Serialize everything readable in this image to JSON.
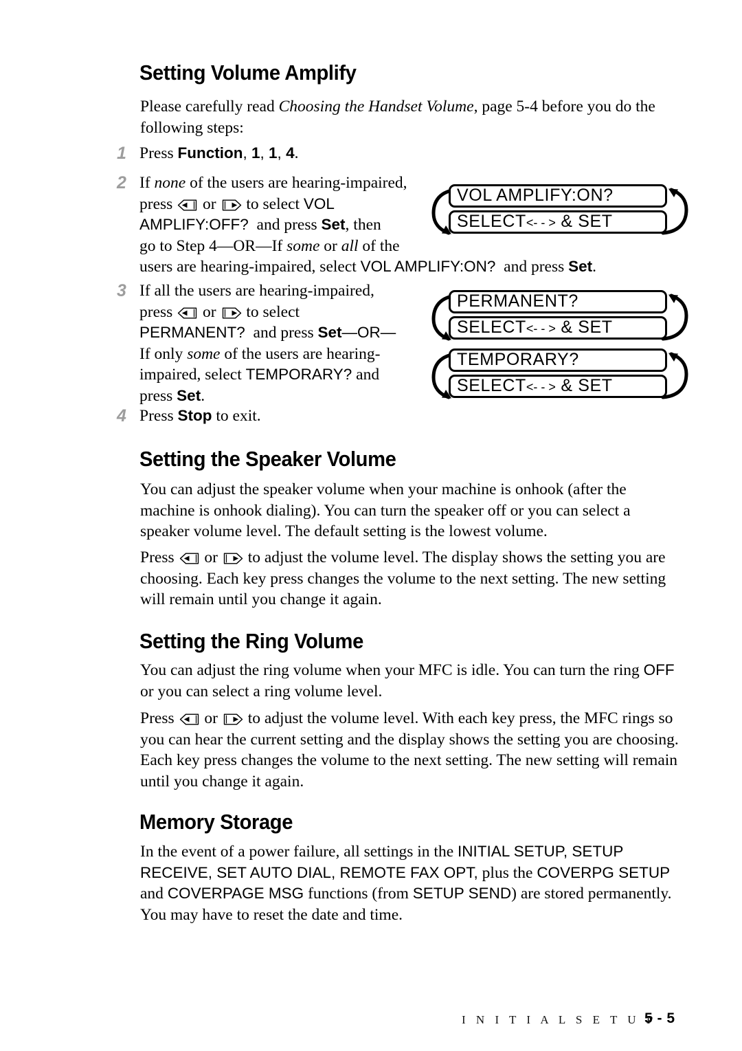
{
  "document": {
    "page_label": "5 - 5",
    "chapter_footer": "I N I T I A L   S E T U P"
  },
  "sections": [
    {
      "id": "volume-amplify",
      "heading": "Setting Volume Amplify",
      "intro_html": "Please carefully read <i>Choosing the Handset Volume</i>, page 5-4 before you do the following steps:",
      "steps": [
        {
          "number": "1",
          "html": "Press <b class=\"sansb\">Function</b><span class=\"sans\">, </span><b class=\"sansb\">1</b><span class=\"sans\">, </span><b class=\"sansb\">1</b><span class=\"sans\">, </span><b class=\"sansb\">4</b>."
        },
        {
          "number": "2",
          "html": "If <i>none</i> of the users are hearing-impaired,<br>press KEYLEFT or KEYRIGHT to select <span class=\"sans\">VOL</span><br><span class=\"sans\">AMPLIFY:OFF?</span>&nbsp; and press <b class=\"sansb\">Set</b>, then<br>go to Step 4—OR—If <i>some</i> or <i>all</i> of the<br>users are hearing-impaired, select <span class=\"sans\">VOL AMPLIFY:ON?</span>&nbsp; and press <b class=\"sansb\">Set</b>."
        },
        {
          "number": "3",
          "html": "If all the users are hearing-impaired,<br>press KEYLEFT or KEYRIGHT to select<br><span class=\"sans\">PERMANENT?</span>&nbsp; and press <b class=\"sansb\">Set</b><span class=\"sans\">—OR—</span><br>If only <i>some</i> of the users are hearing-<br>impaired, select <span class=\"sans\">TEMPORARY?</span> and<br>press <b class=\"sansb\">Set</b>."
        },
        {
          "number": "4",
          "html": "Press <b class=\"sansb\">Stop</b> to exit."
        }
      ],
      "displays": [
        {
          "id": "vol-amplify-on",
          "line1": "VOL AMPLIFY:ON?",
          "line2_pre": "SELECT",
          "line2_arrows": "<- - >",
          "line2_post": " & SET"
        },
        {
          "id": "permanent",
          "line1": "PERMANENT?",
          "line2_pre": "SELECT",
          "line2_arrows": "<- - >",
          "line2_post": " & SET"
        },
        {
          "id": "temporary",
          "line1": "TEMPORARY?",
          "line2_pre": "SELECT",
          "line2_arrows": "<- - >",
          "line2_post": " & SET"
        }
      ]
    },
    {
      "id": "speaker-volume",
      "heading": "Setting the Speaker Volume",
      "paragraphs": [
        "You can adjust the speaker volume when your machine is onhook (after the machine is onhook dialing). You can turn the speaker off or you can select a speaker volume level. The default setting is the lowest volume.",
        "Press KEYLEFT or KEYRIGHT to adjust the volume level. The display shows the setting you are choosing. Each key press changes the volume to the next setting. The new setting will remain until you change it again."
      ]
    },
    {
      "id": "ring-volume",
      "heading": "Setting the Ring Volume",
      "paragraphs": [
        "You can adjust the ring volume when your MFC is idle. You can turn the ring <span class=\"sans\">OFF</span> or you can select a ring volume level.",
        "Press KEYLEFT or KEYRIGHT to adjust the volume level. With each key press, the MFC rings so you can hear the current setting and the display shows the setting you are choosing. Each key press changes the volume to the next setting. The new setting will remain until you change it again."
      ]
    },
    {
      "id": "memory-storage",
      "heading": "Memory Storage",
      "paragraphs": [
        "In the event of a power failure, all settings in the <span class=\"sans\">INITIAL SETUP, SETUP RECEIVE, SET AUTO DIAL, REMOTE FAX OPT,</span> plus the <span class=\"sans\">COVERPG SETUP</span> and <span class=\"sans\">COVERPAGE MSG</span> functions (from <span class=\"sans\">SETUP SEND</span>) are stored permanently. You may have to reset the date and time."
      ]
    }
  ],
  "icons": {
    "left_key": "left-arrow-key-icon",
    "right_key": "right-arrow-key-icon",
    "loop_arrow_left": "loop-arrow-left-icon",
    "loop_arrow_right": "loop-arrow-right-icon"
  },
  "colors": {
    "text": "#000000",
    "step_number": "#9d9d9d",
    "background": "#ffffff"
  }
}
